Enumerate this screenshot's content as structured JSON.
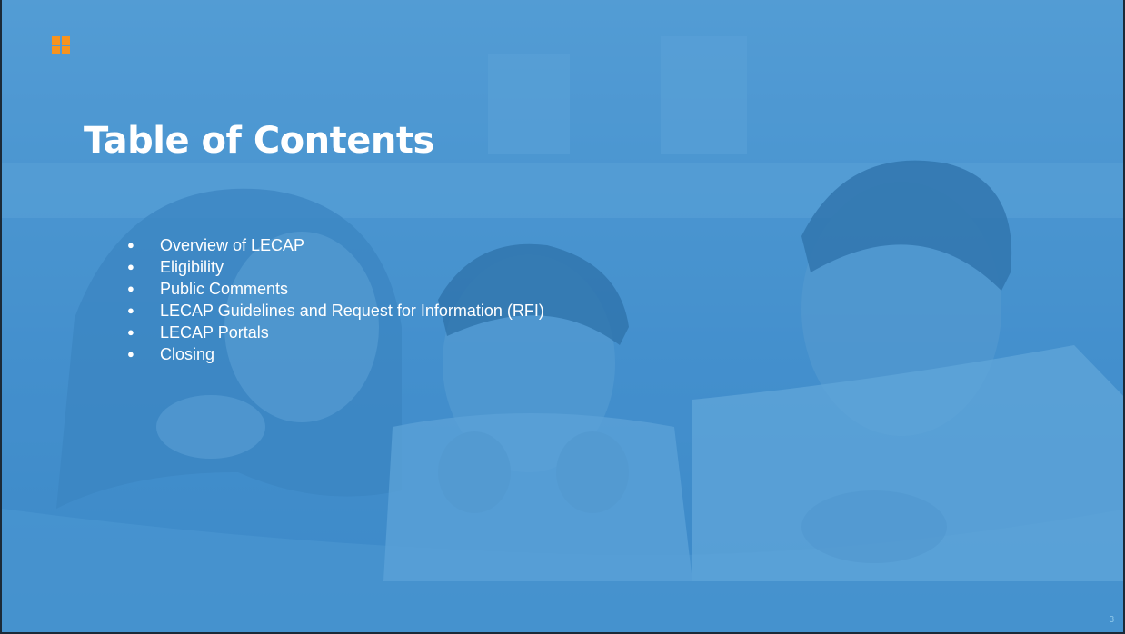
{
  "slide": {
    "title": "Table of Contents",
    "items": [
      "Overview of LECAP",
      "Eligibility",
      "Public Comments",
      "LECAP Guidelines and Request for Information (RFI)",
      "LECAP Portals",
      "Closing"
    ],
    "bullet_glyph": "●",
    "page_number": "3"
  },
  "colors": {
    "overlay_blue": "#3c91d2",
    "logo_orange": "#f7931e",
    "text": "#ffffff"
  },
  "icons": {
    "logo": "four-squares-logo-icon"
  }
}
